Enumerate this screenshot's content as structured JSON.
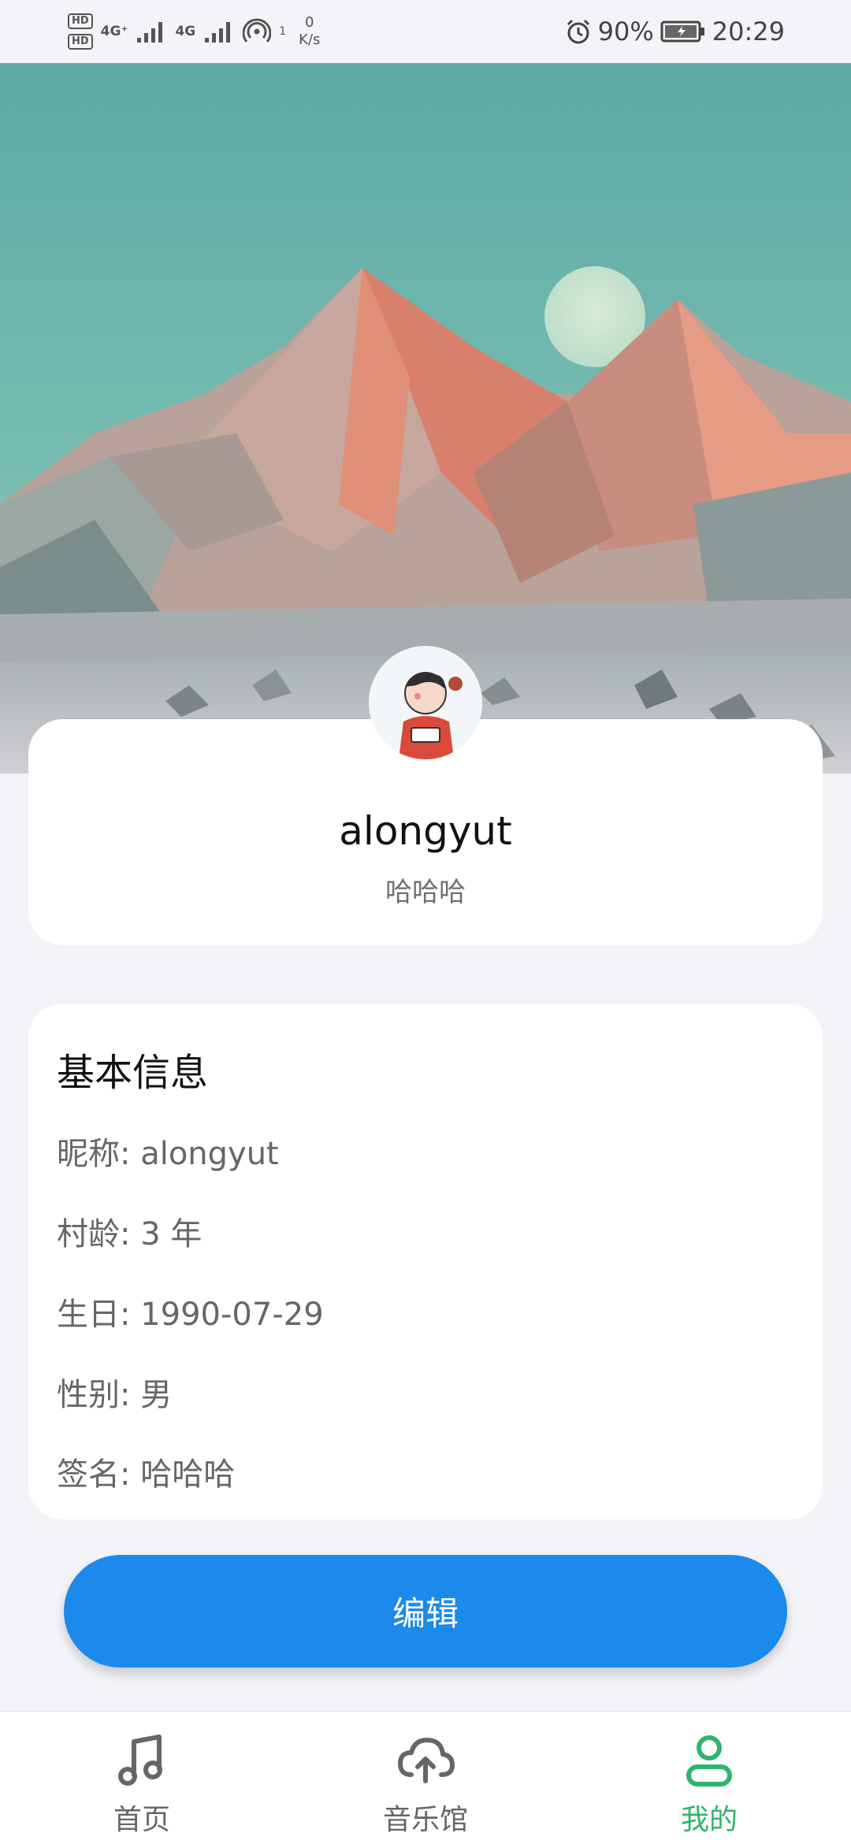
{
  "status_bar": {
    "hd1": "HD",
    "hd2": "HD",
    "sim1": "4G⁺",
    "sim2": "4G",
    "hotspot_count": "1",
    "net_speed_value": "0",
    "net_speed_unit": "K/s",
    "battery": "90%",
    "time": "20:29"
  },
  "profile": {
    "name": "alongyut",
    "signature": "哈哈哈"
  },
  "info": {
    "title": "基本信息",
    "rows": [
      {
        "text": "昵称: alongyut"
      },
      {
        "text": "村龄: 3 年"
      },
      {
        "text": "生日: 1990-07-29"
      },
      {
        "text": "性别: 男"
      },
      {
        "text": "签名: 哈哈哈"
      }
    ]
  },
  "edit_button": {
    "label": "编辑",
    "color": "#1b8aeb"
  },
  "nav": {
    "items": [
      {
        "label": "首页",
        "icon": "music-note-icon"
      },
      {
        "label": "音乐馆",
        "icon": "cloud-upload-icon"
      },
      {
        "label": "我的",
        "icon": "person-icon"
      }
    ],
    "active_color": "#2fb46d"
  }
}
